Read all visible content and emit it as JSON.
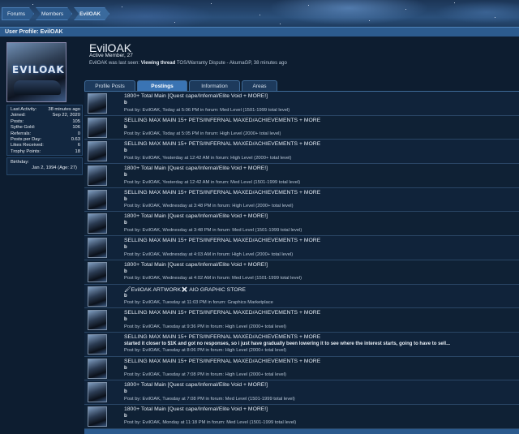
{
  "breadcrumbs": [
    "Forums",
    "Members",
    "EvilOAK"
  ],
  "page_title": "User Profile: EvilOAK",
  "avatar_logo": "EVILOAK",
  "profile": {
    "username": "EvilOAK",
    "title": "Active Member, 27",
    "last_seen_prefix": "EvilOAK was last seen:",
    "last_seen_action": "Viewing thread",
    "last_seen_thread": "TOS/Warranty Dispute - AkumaGP",
    "last_seen_time": ", 38 minutes ago"
  },
  "stats": [
    {
      "label": "Last Activity:",
      "value": "38 minutes ago"
    },
    {
      "label": "Joined:",
      "value": "Sep 22, 2020"
    },
    {
      "label": "Posts:",
      "value": "105"
    },
    {
      "label": "Sythe Gold:",
      "value": "106"
    },
    {
      "label": "Referrals:",
      "value": "0"
    },
    {
      "label": "Posts per Day:",
      "value": "0.63"
    },
    {
      "label": "Likes Received:",
      "value": "6"
    },
    {
      "label": "Trophy Points:",
      "value": "18"
    }
  ],
  "birthday": {
    "label": "Birthday:",
    "value": "Jan 2, 1994 (Age: 27)"
  },
  "tabs": [
    "Profile Posts",
    "Postings",
    "Information",
    "Areas"
  ],
  "active_tab": "Postings",
  "posts": [
    {
      "title": "1800+ Total Main [Quest cape/Infernal/Elite Void + MORE!]",
      "snippet": "b",
      "meta": "Post by: EvilOAK, Today at 5:06 PM in forum: Med Level (1501-1999 total level)"
    },
    {
      "title": "SELLING MAX MAIN 15+ PETS/INFERNAL MAXED/ACHIEVEMENTS + MORE",
      "snippet": "b",
      "meta": "Post by: EvilOAK, Today at 5:05 PM in forum: High Level (2000+ total level)"
    },
    {
      "title": "SELLING MAX MAIN 15+ PETS/INFERNAL MAXED/ACHIEVEMENTS + MORE",
      "snippet": "b",
      "meta": "Post by: EvilOAK, Yesterday at 12:42 AM in forum: High Level (2000+ total level)"
    },
    {
      "title": "1800+ Total Main [Quest cape/Infernal/Elite Void + MORE!]",
      "snippet": "b",
      "meta": "Post by: EvilOAK, Yesterday at 12:42 AM in forum: Med Level (1501-1999 total level)"
    },
    {
      "title": "SELLING MAX MAIN 15+ PETS/INFERNAL MAXED/ACHIEVEMENTS + MORE",
      "snippet": "b",
      "meta": "Post by: EvilOAK, Wednesday at 3:48 PM in forum: High Level (2000+ total level)"
    },
    {
      "title": "1800+ Total Main [Quest cape/Infernal/Elite Void + MORE!]",
      "snippet": "b",
      "meta": "Post by: EvilOAK, Wednesday at 3:48 PM in forum: Med Level (1501-1999 total level)"
    },
    {
      "title": "SELLING MAX MAIN 15+ PETS/INFERNAL MAXED/ACHIEVEMENTS + MORE",
      "snippet": "b",
      "meta": "Post by: EvilOAK, Wednesday at 4:03 AM in forum: High Level (2000+ total level)"
    },
    {
      "title": "1800+ Total Main [Quest cape/Infernal/Elite Void + MORE!]",
      "snippet": "b",
      "meta": "Post by: EvilOAK, Wednesday at 4:02 AM in forum: Med Level (1501-1999 total level)"
    },
    {
      "title": "🖌EvilOAK ARTWORK✖ AIO GRAPHIC STORE",
      "snippet": "b",
      "meta": "Post by: EvilOAK, Tuesday at 11:03 PM in forum: Graphics Marketplace"
    },
    {
      "title": "SELLING MAX MAIN 15+ PETS/INFERNAL MAXED/ACHIEVEMENTS + MORE",
      "snippet": "b",
      "meta": "Post by: EvilOAK, Tuesday at 9:36 PM in forum: High Level (2000+ total level)"
    },
    {
      "title": "SELLING MAX MAIN 15+ PETS/INFERNAL MAXED/ACHIEVEMENTS + MORE",
      "snippet": "started it closer to $1K and got no responses, so i just have gradually been lowering it to see where the interest starts, going to have to sell...",
      "meta": "Post by: EvilOAK, Tuesday at 8:06 PM in forum: High Level (2000+ total level)"
    },
    {
      "title": "SELLING MAX MAIN 15+ PETS/INFERNAL MAXED/ACHIEVEMENTS + MORE",
      "snippet": "b",
      "meta": "Post by: EvilOAK, Tuesday at 7:08 PM in forum: High Level (2000+ total level)"
    },
    {
      "title": "1800+ Total Main [Quest cape/Infernal/Elite Void + MORE!]",
      "snippet": "b",
      "meta": "Post by: EvilOAK, Tuesday at 7:08 PM in forum: Med Level (1501-1999 total level)"
    },
    {
      "title": "1800+ Total Main [Quest cape/Infernal/Elite Void + MORE!]",
      "snippet": "b",
      "meta": "Post by: EvilOAK, Monday at 11:18 PM in forum: Med Level (1501-1999 total level)"
    }
  ]
}
